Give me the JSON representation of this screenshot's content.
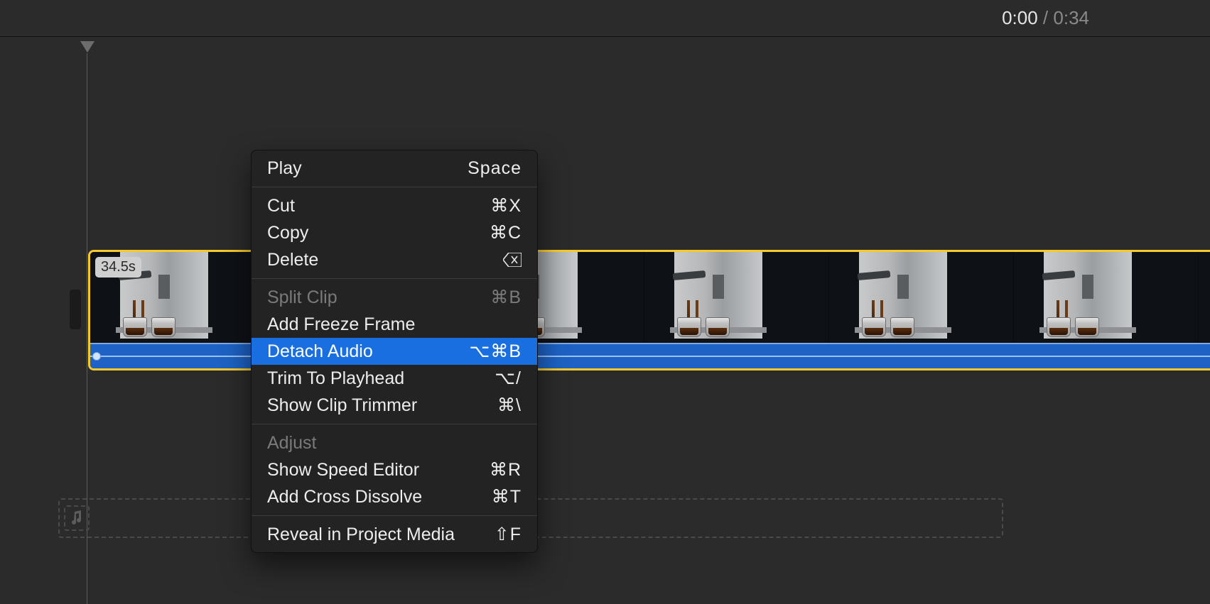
{
  "time": {
    "current": "0:00",
    "separator": "/",
    "total": "0:34"
  },
  "clip": {
    "durationBadge": "34.5s"
  },
  "menu": {
    "items": [
      {
        "label": "Play",
        "shortcut": "Space"
      },
      {
        "label": "Cut",
        "shortcut": "⌘X"
      },
      {
        "label": "Copy",
        "shortcut": "⌘C"
      },
      {
        "label": "Delete"
      },
      {
        "label": "Split Clip",
        "shortcut": "⌘B"
      },
      {
        "label": "Add Freeze Frame"
      },
      {
        "label": "Detach Audio",
        "shortcut": "⌥⌘B"
      },
      {
        "label": "Trim To Playhead",
        "shortcut": "⌥/"
      },
      {
        "label": "Show Clip Trimmer",
        "shortcut": "⌘\\"
      },
      {
        "label": "Adjust"
      },
      {
        "label": "Show Speed Editor",
        "shortcut": "⌘R"
      },
      {
        "label": "Add Cross Dissolve",
        "shortcut": "⌘T"
      },
      {
        "label": "Reveal in Project Media",
        "shortcut": "⇧F"
      }
    ]
  }
}
